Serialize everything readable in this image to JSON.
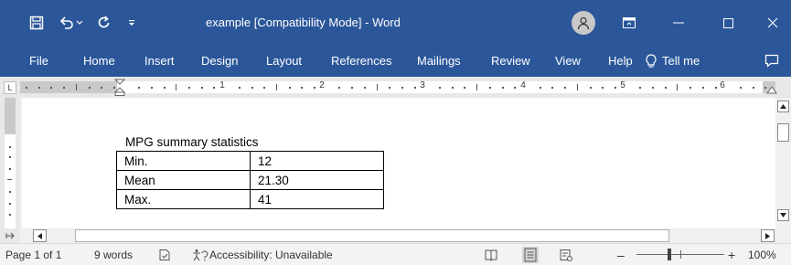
{
  "app": {
    "title": "example [Compatibility Mode]  -  Word"
  },
  "ribbon": {
    "tabs": [
      {
        "label": "File"
      },
      {
        "label": "Home"
      },
      {
        "label": "Insert"
      },
      {
        "label": "Design"
      },
      {
        "label": "Layout"
      },
      {
        "label": "References"
      },
      {
        "label": "Mailings"
      },
      {
        "label": "Review"
      },
      {
        "label": "View"
      },
      {
        "label": "Help"
      }
    ],
    "tell_me": "Tell me"
  },
  "ruler": {
    "numbers": [
      "1",
      "2",
      "3",
      "4",
      "5",
      "6"
    ],
    "tab_selector": "L"
  },
  "document": {
    "caption": "MPG summary statistics",
    "table": [
      {
        "label": "Min.",
        "value": "12"
      },
      {
        "label": "Mean",
        "value": "21.30"
      },
      {
        "label": "Max.",
        "value": "41"
      }
    ]
  },
  "status": {
    "page": "Page 1 of 1",
    "words": "9 words",
    "accessibility": "Accessibility: Unavailable",
    "zoom_minus": "–",
    "zoom_plus": "+",
    "zoom": "100%",
    "zoom_level": 1.0
  },
  "icons": {
    "save": "save-icon",
    "undo": "undo-icon",
    "redo": "redo-icon",
    "customize": "customize-quick-access-icon",
    "account": "avatar-icon",
    "ribbon_display": "ribbon-display-options-icon",
    "minimize": "minimize-icon",
    "maximize": "maximize-icon",
    "close": "close-icon",
    "lightbulb": "lightbulb-icon",
    "comments": "comment-icon",
    "proofing": "proofing-icon",
    "accessibility": "accessibility-icon",
    "read_mode": "read-mode-icon",
    "print_layout": "print-layout-icon",
    "web_layout": "web-layout-icon"
  },
  "colors": {
    "accent": "#2b579a",
    "status_bar": "#f3f3f3",
    "canvas": "#f0f0f0"
  }
}
